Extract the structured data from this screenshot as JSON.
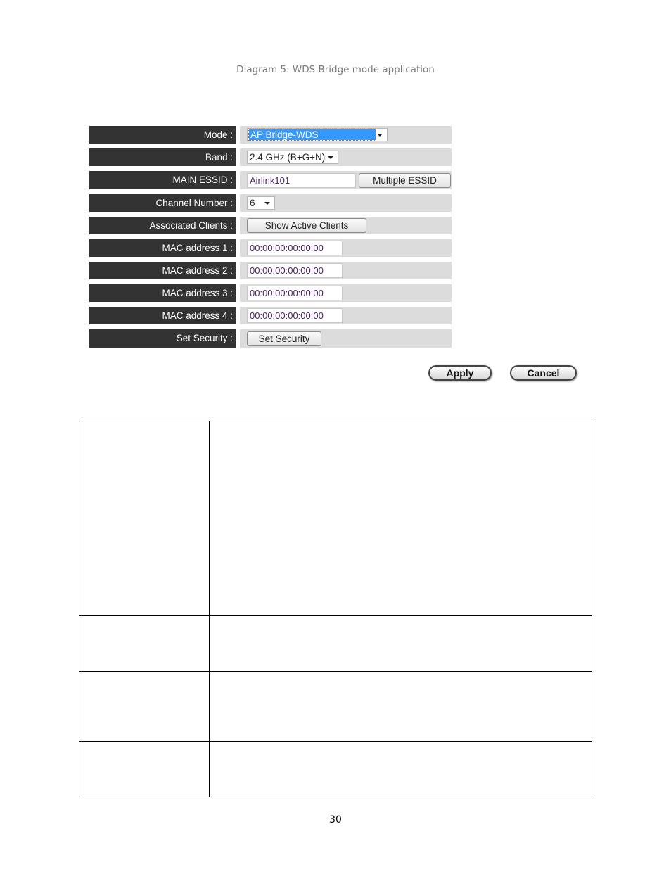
{
  "caption": "Diagram 5: WDS Bridge mode application",
  "form": {
    "mode": {
      "label": "Mode :",
      "value": "AP Bridge-WDS"
    },
    "band": {
      "label": "Band :",
      "value": "2.4 GHz (B+G+N)"
    },
    "essid": {
      "label": "MAIN ESSID :",
      "value": "Airlink101",
      "button": "Multiple ESSID"
    },
    "channel": {
      "label": "Channel Number :",
      "value": "6"
    },
    "clients": {
      "label": "Associated Clients :",
      "button": "Show Active Clients"
    },
    "mac": [
      {
        "label": "MAC address 1 :",
        "value": "00:00:00:00:00:00"
      },
      {
        "label": "MAC address 2 :",
        "value": "00:00:00:00:00:00"
      },
      {
        "label": "MAC address 3 :",
        "value": "00:00:00:00:00:00"
      },
      {
        "label": "MAC address 4 :",
        "value": "00:00:00:00:00:00"
      }
    ],
    "security": {
      "label": "Set Security :",
      "button": "Set Security"
    }
  },
  "actions": {
    "apply": "Apply",
    "cancel": "Cancel"
  },
  "table": {
    "rows": [
      [
        "",
        ""
      ],
      [
        "",
        ""
      ],
      [
        "",
        ""
      ],
      [
        "",
        ""
      ]
    ]
  },
  "page_number": "30"
}
